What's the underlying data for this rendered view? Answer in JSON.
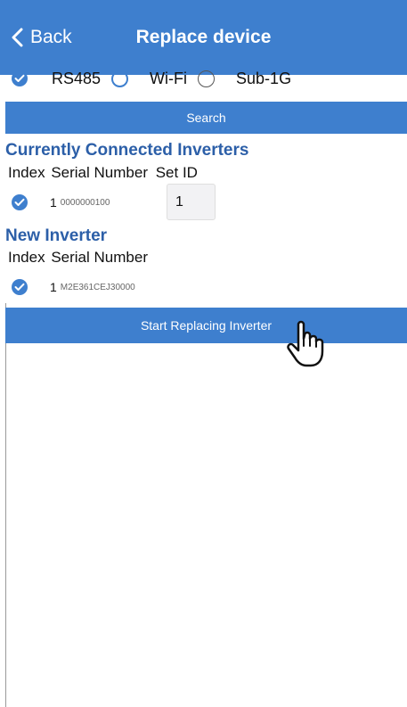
{
  "navbar": {
    "back_label": "Back",
    "title": "Replace device"
  },
  "connection": {
    "options": [
      {
        "label": "RS485",
        "selected": true
      },
      {
        "label": "Wi-Fi",
        "selected": false
      },
      {
        "label": "Sub-1G",
        "selected": false
      }
    ]
  },
  "search": {
    "label": "Search"
  },
  "current": {
    "section_title": "Currently Connected Inverters",
    "headers": {
      "index": "Index",
      "serial": "Serial Number",
      "set_id": "Set ID"
    },
    "rows": [
      {
        "index": "1",
        "serial": "0000000100",
        "set_id": "1",
        "selected": true
      }
    ]
  },
  "new_inverter": {
    "section_title": "New Inverter",
    "headers": {
      "index": "Index",
      "serial": "Serial Number"
    },
    "rows": [
      {
        "index": "1",
        "serial": "M2E361CEJ30000",
        "selected": true
      }
    ]
  },
  "start_button": {
    "label": "Start Replacing Inverter"
  },
  "colors": {
    "primary": "#3e7fce",
    "section_title": "#2c5fa8"
  },
  "icons": {
    "back": "chevron-left-icon",
    "checked": "checkmark-circle-icon",
    "unchecked": "empty-radio-icon",
    "cursor": "hand-pointer-icon"
  }
}
